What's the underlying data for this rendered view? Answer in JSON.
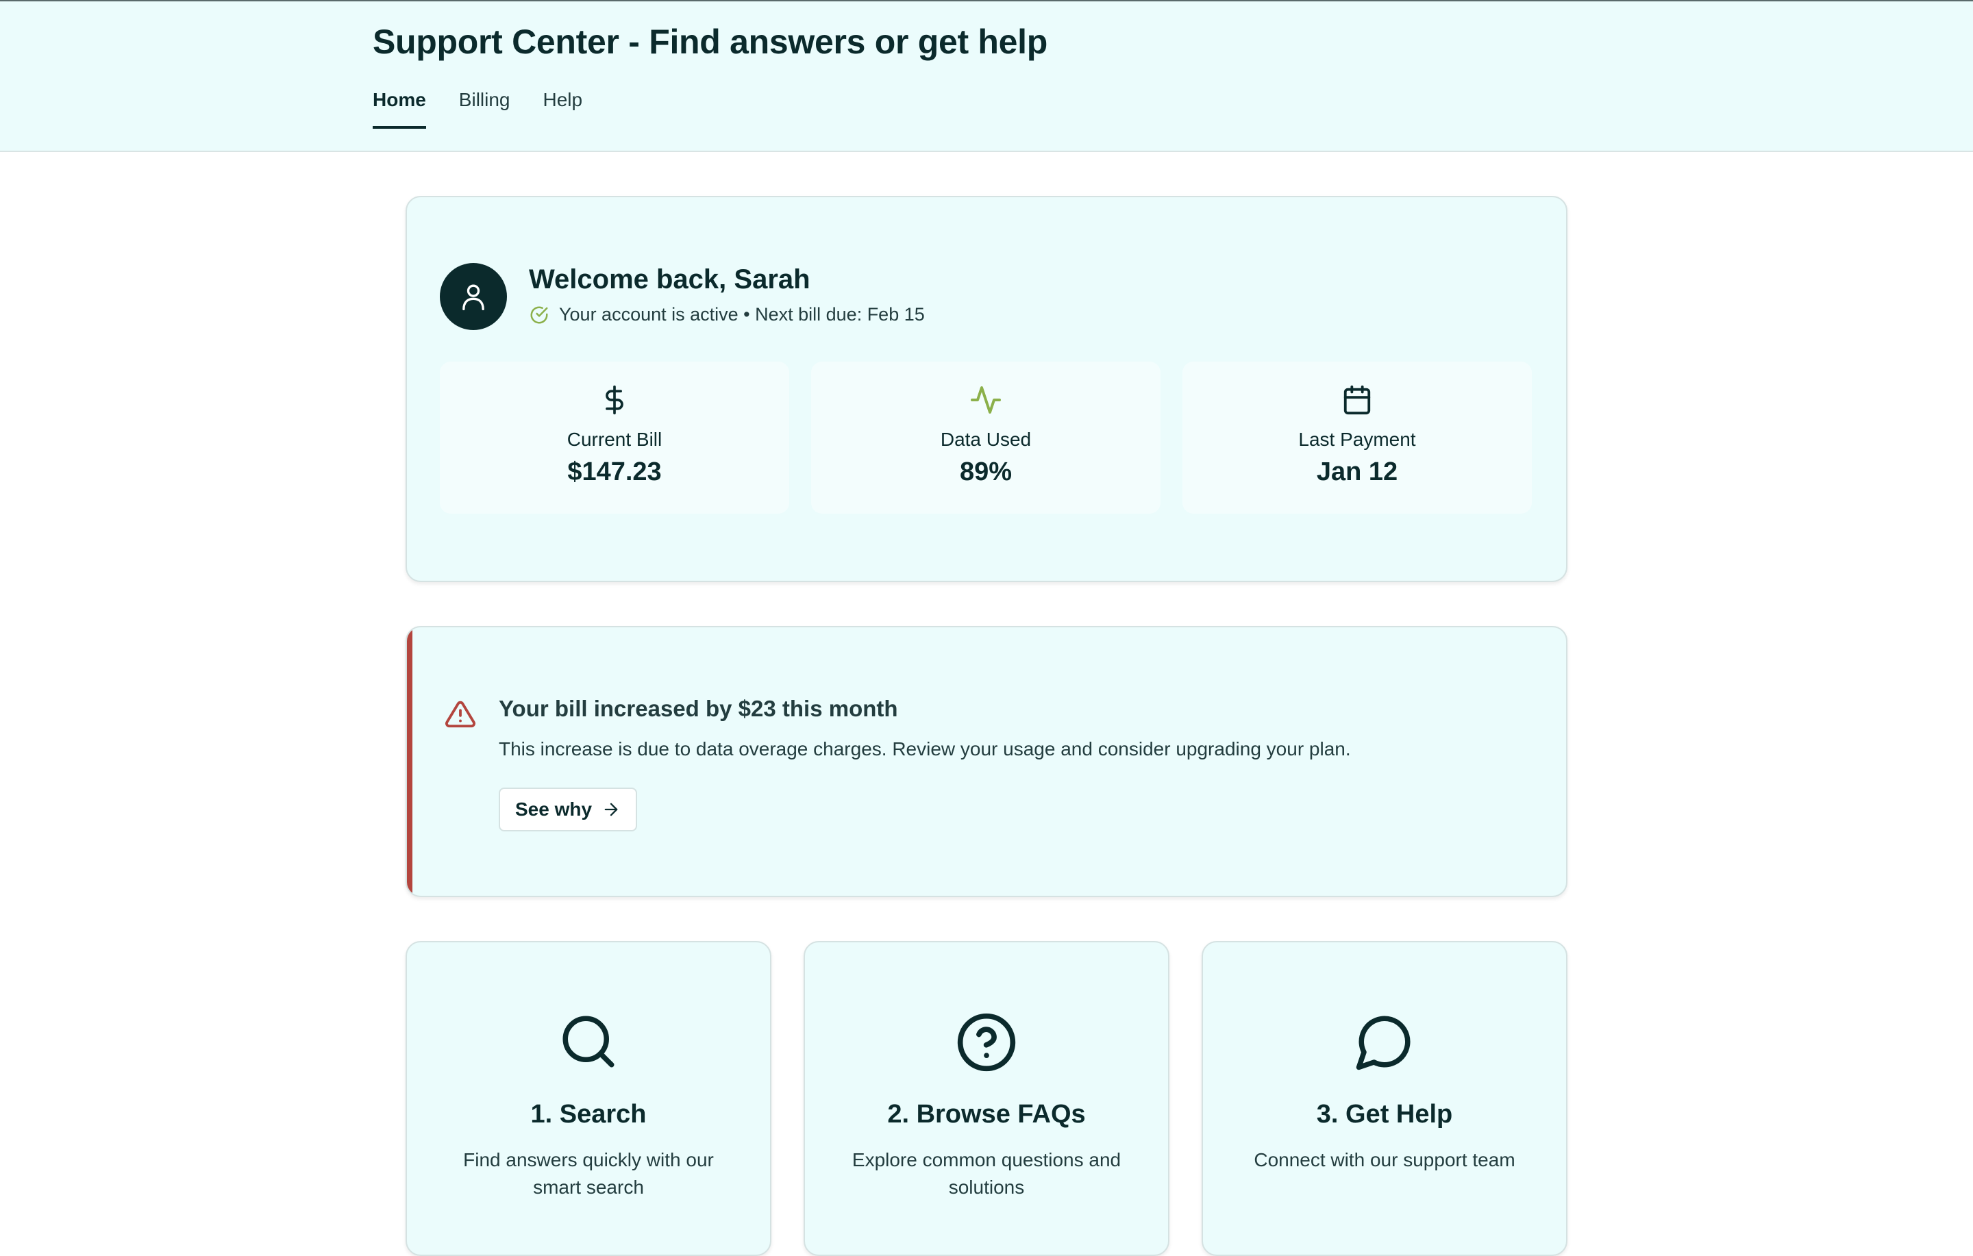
{
  "header": {
    "title": "Support Center - Find answers or get help",
    "tabs": [
      {
        "label": "Home",
        "active": true
      },
      {
        "label": "Billing",
        "active": false
      },
      {
        "label": "Help",
        "active": false
      }
    ]
  },
  "welcome": {
    "title": "Welcome back, Sarah",
    "status": "Your account is active • Next bill due: Feb 15",
    "stats": [
      {
        "icon": "dollar-icon",
        "label": "Current Bill",
        "value": "$147.23"
      },
      {
        "icon": "activity-icon",
        "label": "Data Used",
        "value": "89%"
      },
      {
        "icon": "calendar-icon",
        "label": "Last Payment",
        "value": "Jan 12"
      }
    ]
  },
  "alert": {
    "title": "Your bill increased by $23 this month",
    "body": "This increase is due to data overage charges. Review your usage and consider upgrading your plan.",
    "button": "See why"
  },
  "steps": [
    {
      "icon": "search-icon",
      "title": "1. Search",
      "desc": "Find answers quickly with our smart search"
    },
    {
      "icon": "question-icon",
      "title": "2. Browse FAQs",
      "desc": "Explore common questions and solutions"
    },
    {
      "icon": "chat-icon",
      "title": "3. Get Help",
      "desc": "Connect with our support team"
    }
  ],
  "colors": {
    "primary": "#0b2a2c",
    "background": "#ebfcfc",
    "success": "#8bb04a",
    "alert": "#b3453e"
  }
}
